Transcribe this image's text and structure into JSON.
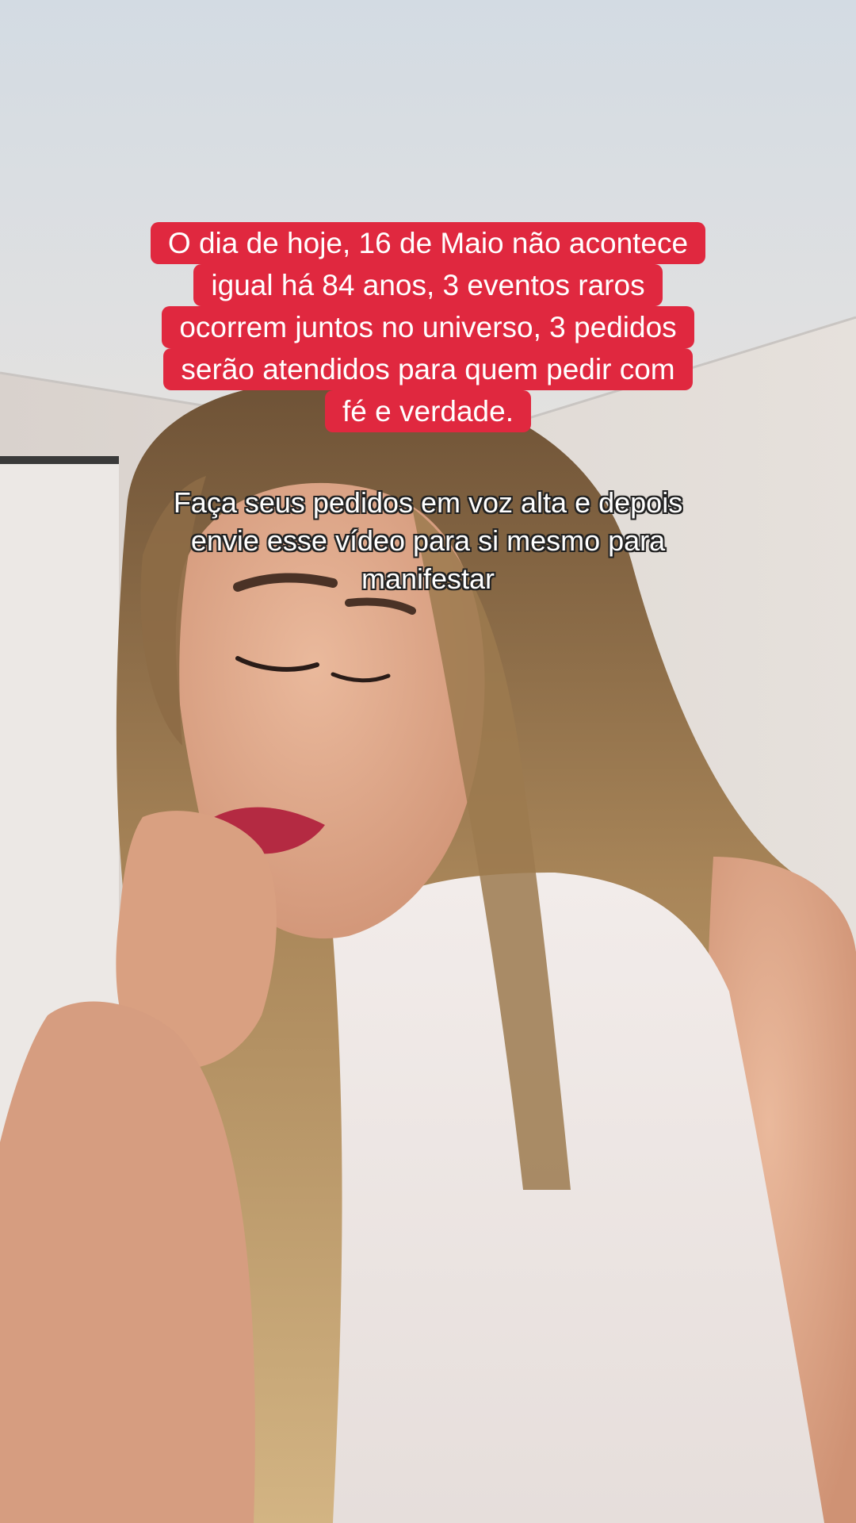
{
  "overlay_red": {
    "lines": [
      "O dia de hoje, 16 de Maio não acontece",
      "igual há 84 anos, 3 eventos raros",
      "ocorrem juntos no universo, 3 pedidos",
      "serão atendidos para quem pedir com",
      "fé e verdade."
    ],
    "background_color": "#e0283f",
    "text_color": "#ffffff"
  },
  "overlay_white": {
    "lines": [
      "Faça seus pedidos em voz alta e depois",
      "envie esse vídeo para si mesmo para",
      "manifestar"
    ],
    "text_color": "#ffffff"
  }
}
